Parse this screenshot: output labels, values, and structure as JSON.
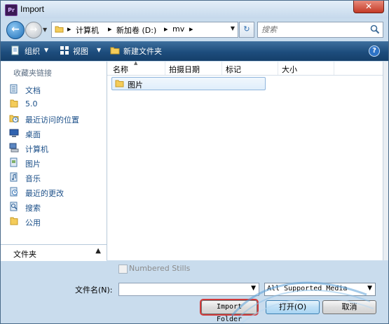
{
  "window": {
    "title": "Import",
    "app_icon": "Pr",
    "close": "✕"
  },
  "address": {
    "crumbs": [
      "计算机",
      "新加卷 (D:)",
      "mv"
    ],
    "search_placeholder": "搜索"
  },
  "toolbar": {
    "organize": "组织",
    "views": "视图",
    "new_folder": "新建文件夹",
    "help": "?"
  },
  "nav": {
    "favorites_header": "收藏夹链接",
    "items": [
      {
        "label": "文档",
        "icon": "documents-icon"
      },
      {
        "label": "5.0",
        "icon": "folder-icon"
      },
      {
        "label": "最近访问的位置",
        "icon": "recent-places-icon"
      },
      {
        "label": "桌面",
        "icon": "desktop-icon"
      },
      {
        "label": "计算机",
        "icon": "computer-icon"
      },
      {
        "label": "图片",
        "icon": "pictures-icon"
      },
      {
        "label": "音乐",
        "icon": "music-icon"
      },
      {
        "label": "最近的更改",
        "icon": "recent-changes-icon"
      },
      {
        "label": "搜索",
        "icon": "search-icon"
      },
      {
        "label": "公用",
        "icon": "folder-icon"
      }
    ],
    "folders_label": "文件夹"
  },
  "columns": [
    "名称",
    "拍摄日期",
    "标记",
    "大小"
  ],
  "files": [
    {
      "name": "图片",
      "icon": "folder-icon"
    }
  ],
  "bottom": {
    "numbered_stills": "Numbered Stills",
    "filename_label": "文件名(N):",
    "filename_value": "",
    "filetype": "All Supported Media",
    "import_folder": "Import Folder",
    "open": "打开(O)",
    "cancel": "取消"
  },
  "colors": {
    "accent": "#1d4d7d",
    "highlight": "#d23a3a"
  }
}
